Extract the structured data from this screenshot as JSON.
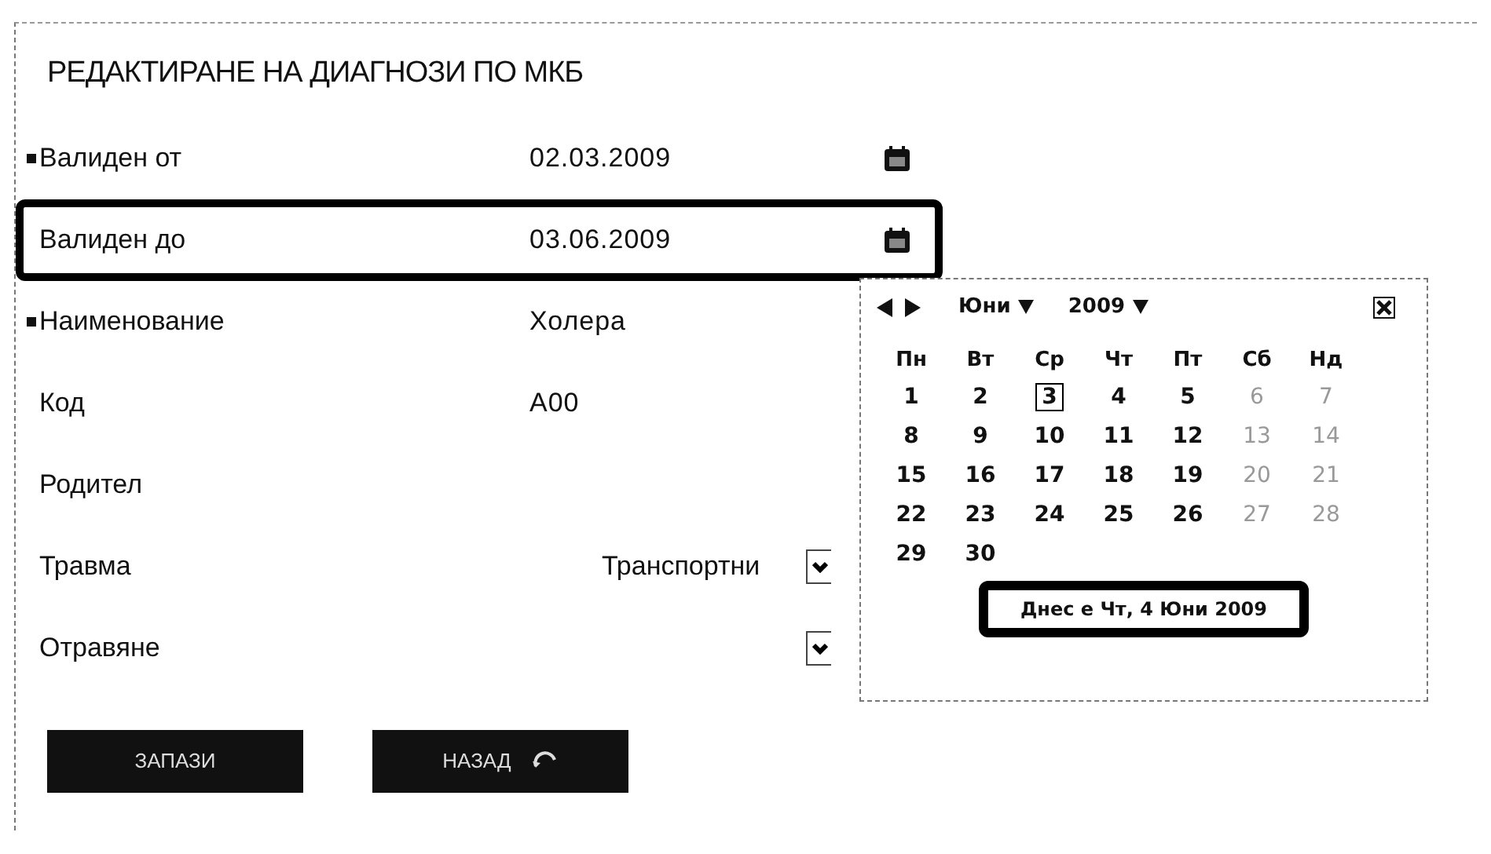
{
  "title": "РЕДАКТИРАНЕ НА ДИАГНОЗИ ПО МКБ",
  "fields": [
    {
      "label": "Валиден от",
      "required": true,
      "kind": "date",
      "value": "02.03.2009",
      "highlighted": false
    },
    {
      "label": "Валиден до",
      "required": false,
      "kind": "date",
      "value": "03.06.2009",
      "highlighted": true
    },
    {
      "label": "Наименование",
      "required": true,
      "kind": "text",
      "value": "Холера",
      "highlighted": false
    },
    {
      "label": "Код",
      "required": false,
      "kind": "text",
      "value": "A00",
      "highlighted": false
    },
    {
      "label": "Родител",
      "required": false,
      "kind": "text",
      "highlighted": false
    },
    {
      "label": "Травма",
      "required": false,
      "kind": "select",
      "value": "Транспортни",
      "highlighted": false
    },
    {
      "label": "Отравяне",
      "required": false,
      "kind": "select",
      "highlighted": false
    }
  ],
  "calendar": {
    "month": "Юни",
    "year": "2009",
    "weekdays": [
      "Пн",
      "Вт",
      "Ср",
      "Чт",
      "Пт",
      "Сб",
      "Нд"
    ],
    "weeks": [
      [
        {
          "day": "1",
          "muted": false,
          "selected": false
        },
        {
          "day": "2",
          "muted": false,
          "selected": false
        },
        {
          "day": "3",
          "muted": false,
          "selected": true
        },
        {
          "day": "4",
          "muted": false,
          "selected": false
        },
        {
          "day": "5",
          "muted": false,
          "selected": false
        },
        {
          "day": "6",
          "muted": true,
          "selected": false
        },
        {
          "day": "7",
          "muted": true,
          "selected": false
        }
      ],
      [
        {
          "day": "8",
          "muted": false,
          "selected": false
        },
        {
          "day": "9",
          "muted": false,
          "selected": false
        },
        {
          "day": "10",
          "muted": false,
          "selected": false
        },
        {
          "day": "11",
          "muted": false,
          "selected": false
        },
        {
          "day": "12",
          "muted": false,
          "selected": false
        },
        {
          "day": "13",
          "muted": true,
          "selected": false
        },
        {
          "day": "14",
          "muted": true,
          "selected": false
        }
      ],
      [
        {
          "day": "15",
          "muted": false,
          "selected": false
        },
        {
          "day": "16",
          "muted": false,
          "selected": false
        },
        {
          "day": "17",
          "muted": false,
          "selected": false
        },
        {
          "day": "18",
          "muted": false,
          "selected": false
        },
        {
          "day": "19",
          "muted": false,
          "selected": false
        },
        {
          "day": "20",
          "muted": true,
          "selected": false
        },
        {
          "day": "21",
          "muted": true,
          "selected": false
        }
      ],
      [
        {
          "day": "22",
          "muted": false,
          "selected": false
        },
        {
          "day": "23",
          "muted": false,
          "selected": false
        },
        {
          "day": "24",
          "muted": false,
          "selected": false
        },
        {
          "day": "25",
          "muted": false,
          "selected": false
        },
        {
          "day": "26",
          "muted": false,
          "selected": false
        },
        {
          "day": "27",
          "muted": true,
          "selected": false
        },
        {
          "day": "28",
          "muted": true,
          "selected": false
        }
      ],
      [
        {
          "day": "29",
          "muted": false,
          "selected": false
        },
        {
          "day": "30",
          "muted": false,
          "selected": false
        }
      ]
    ],
    "today": "Днес е Чт, 4 Юни 2009",
    "today_highlighted": true
  },
  "buttons": [
    {
      "label": "ЗАПАЗИ",
      "kind": "plain"
    },
    {
      "label": "НАЗАД",
      "kind": "back"
    }
  ]
}
